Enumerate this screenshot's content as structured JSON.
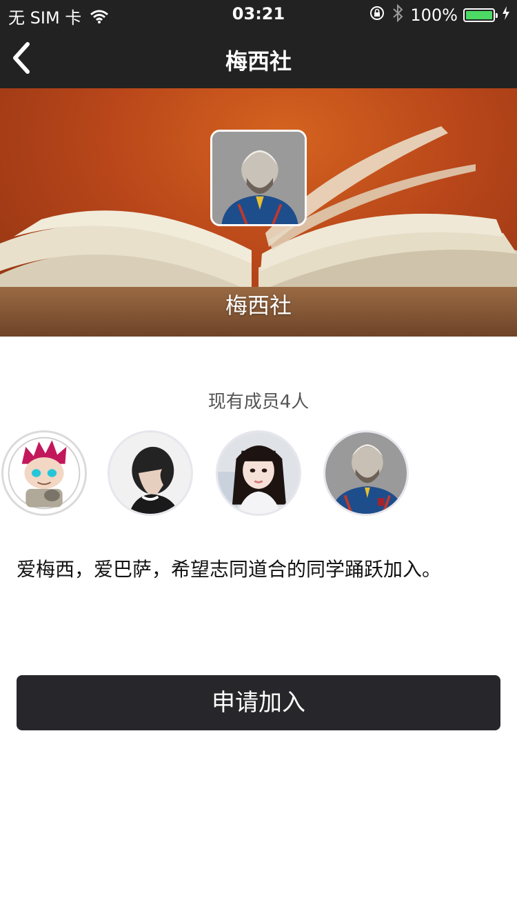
{
  "status_bar": {
    "carrier": "无 SIM 卡",
    "time": "03:21",
    "battery": "100%",
    "battery_level": 1.0,
    "icons": [
      "wifi-icon",
      "orientation-lock-icon",
      "bluetooth-icon",
      "battery-icon",
      "charging-icon"
    ]
  },
  "nav": {
    "title": "梅西社",
    "back_icon": "chevron-left-icon"
  },
  "hero": {
    "club_name": "梅西社",
    "background": "open-book-on-orange-background"
  },
  "members": {
    "count_label": "现有成员4人",
    "avatars": [
      {
        "name": "member-avatar-cartoon"
      },
      {
        "name": "member-avatar-boy"
      },
      {
        "name": "member-avatar-girl"
      },
      {
        "name": "member-avatar-messi"
      }
    ]
  },
  "description": "爱梅西，爱巴萨，希望志同道合的同学踊跃加入。",
  "join_button": {
    "label": "申请加入"
  },
  "colors": {
    "bar_background": "#222222",
    "button_background": "#27272b",
    "battery_green": "#4cd964",
    "hero_orange": "#c4521b"
  }
}
